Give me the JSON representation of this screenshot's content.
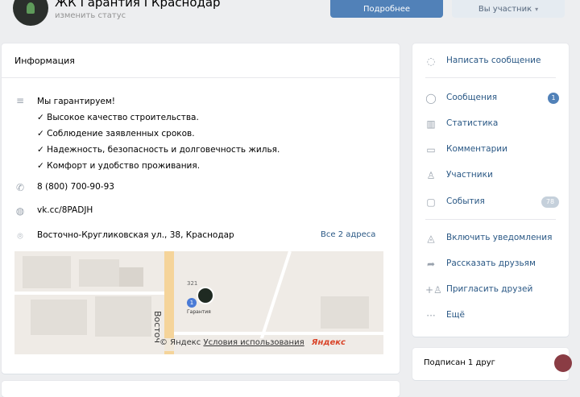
{
  "group": {
    "title": "ЖК Гарантия I Краснодар",
    "status": "изменить статус"
  },
  "buttons": {
    "more": "Подробнее",
    "member": "Вы участник"
  },
  "info": {
    "heading": "Информация",
    "description": [
      "Мы гарантируем!",
      "✓ Высокое качество строительства.",
      "✓ Соблюдение заявленных сроков.",
      "✓ Надежность, безопасность и долговечность жилья.",
      "✓ Комфорт и удобство проживания."
    ],
    "phone": "8 (800) 700-90-93",
    "link": "vk.cc/8PADJH",
    "address": "Восточно-Кругликовская ул., 38, Краснодар",
    "all_addresses": "Все 2 адреса"
  },
  "map": {
    "street": "Восточ",
    "pin_label": "Гарантия",
    "pin_number": "1",
    "house_number": "321",
    "footer_copy": "© Яндекс",
    "footer_terms": "Условия использования",
    "footer_logo": "Яндекс"
  },
  "menu": {
    "items": [
      {
        "label": "Написать сообщение",
        "icon": "message-icon"
      },
      {
        "label": "Сообщения",
        "icon": "messages-icon",
        "badge": "1"
      },
      {
        "label": "Статистика",
        "icon": "statistics-icon"
      },
      {
        "label": "Комментарии",
        "icon": "comments-icon"
      },
      {
        "label": "Участники",
        "icon": "members-icon"
      },
      {
        "label": "События",
        "icon": "events-icon",
        "badge": "78"
      },
      {
        "label": "Включить уведомления",
        "icon": "bell-icon"
      },
      {
        "label": "Рассказать друзьям",
        "icon": "share-icon"
      },
      {
        "label": "Пригласить друзей",
        "icon": "invite-icon"
      },
      {
        "label": "Ещё",
        "icon": "more-icon"
      }
    ]
  },
  "subscribed": {
    "text": "Подписан 1 друг"
  },
  "colors": {
    "accent": "#5181b8",
    "link": "#2a5885",
    "background": "#edeef0"
  }
}
